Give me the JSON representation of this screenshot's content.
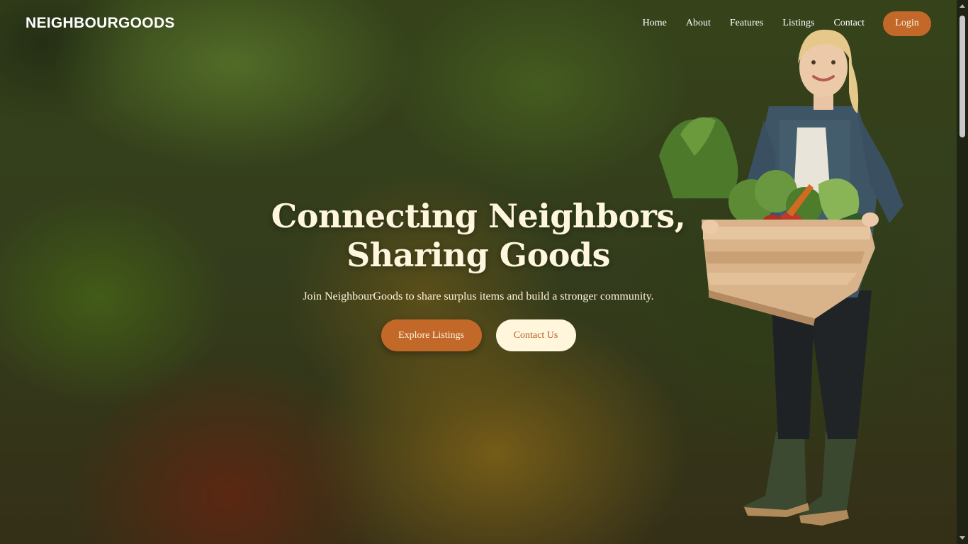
{
  "brand": "NEIGHBOURGOODS",
  "nav": {
    "links": [
      "Home",
      "About",
      "Features",
      "Listings",
      "Contact"
    ],
    "login_label": "Login"
  },
  "hero": {
    "title_line1": "Connecting Neighbors,",
    "title_line2": "Sharing Goods",
    "subtitle": "Join NeighbourGoods to share surplus items and build a stronger community.",
    "primary_button": "Explore Listings",
    "secondary_button": "Contact Us"
  },
  "colors": {
    "accent": "#c2692a",
    "cream": "#fff6dc",
    "background": "#3a4420"
  },
  "icons": {
    "hero_image": "woman-with-vegetable-crate-illustration"
  }
}
